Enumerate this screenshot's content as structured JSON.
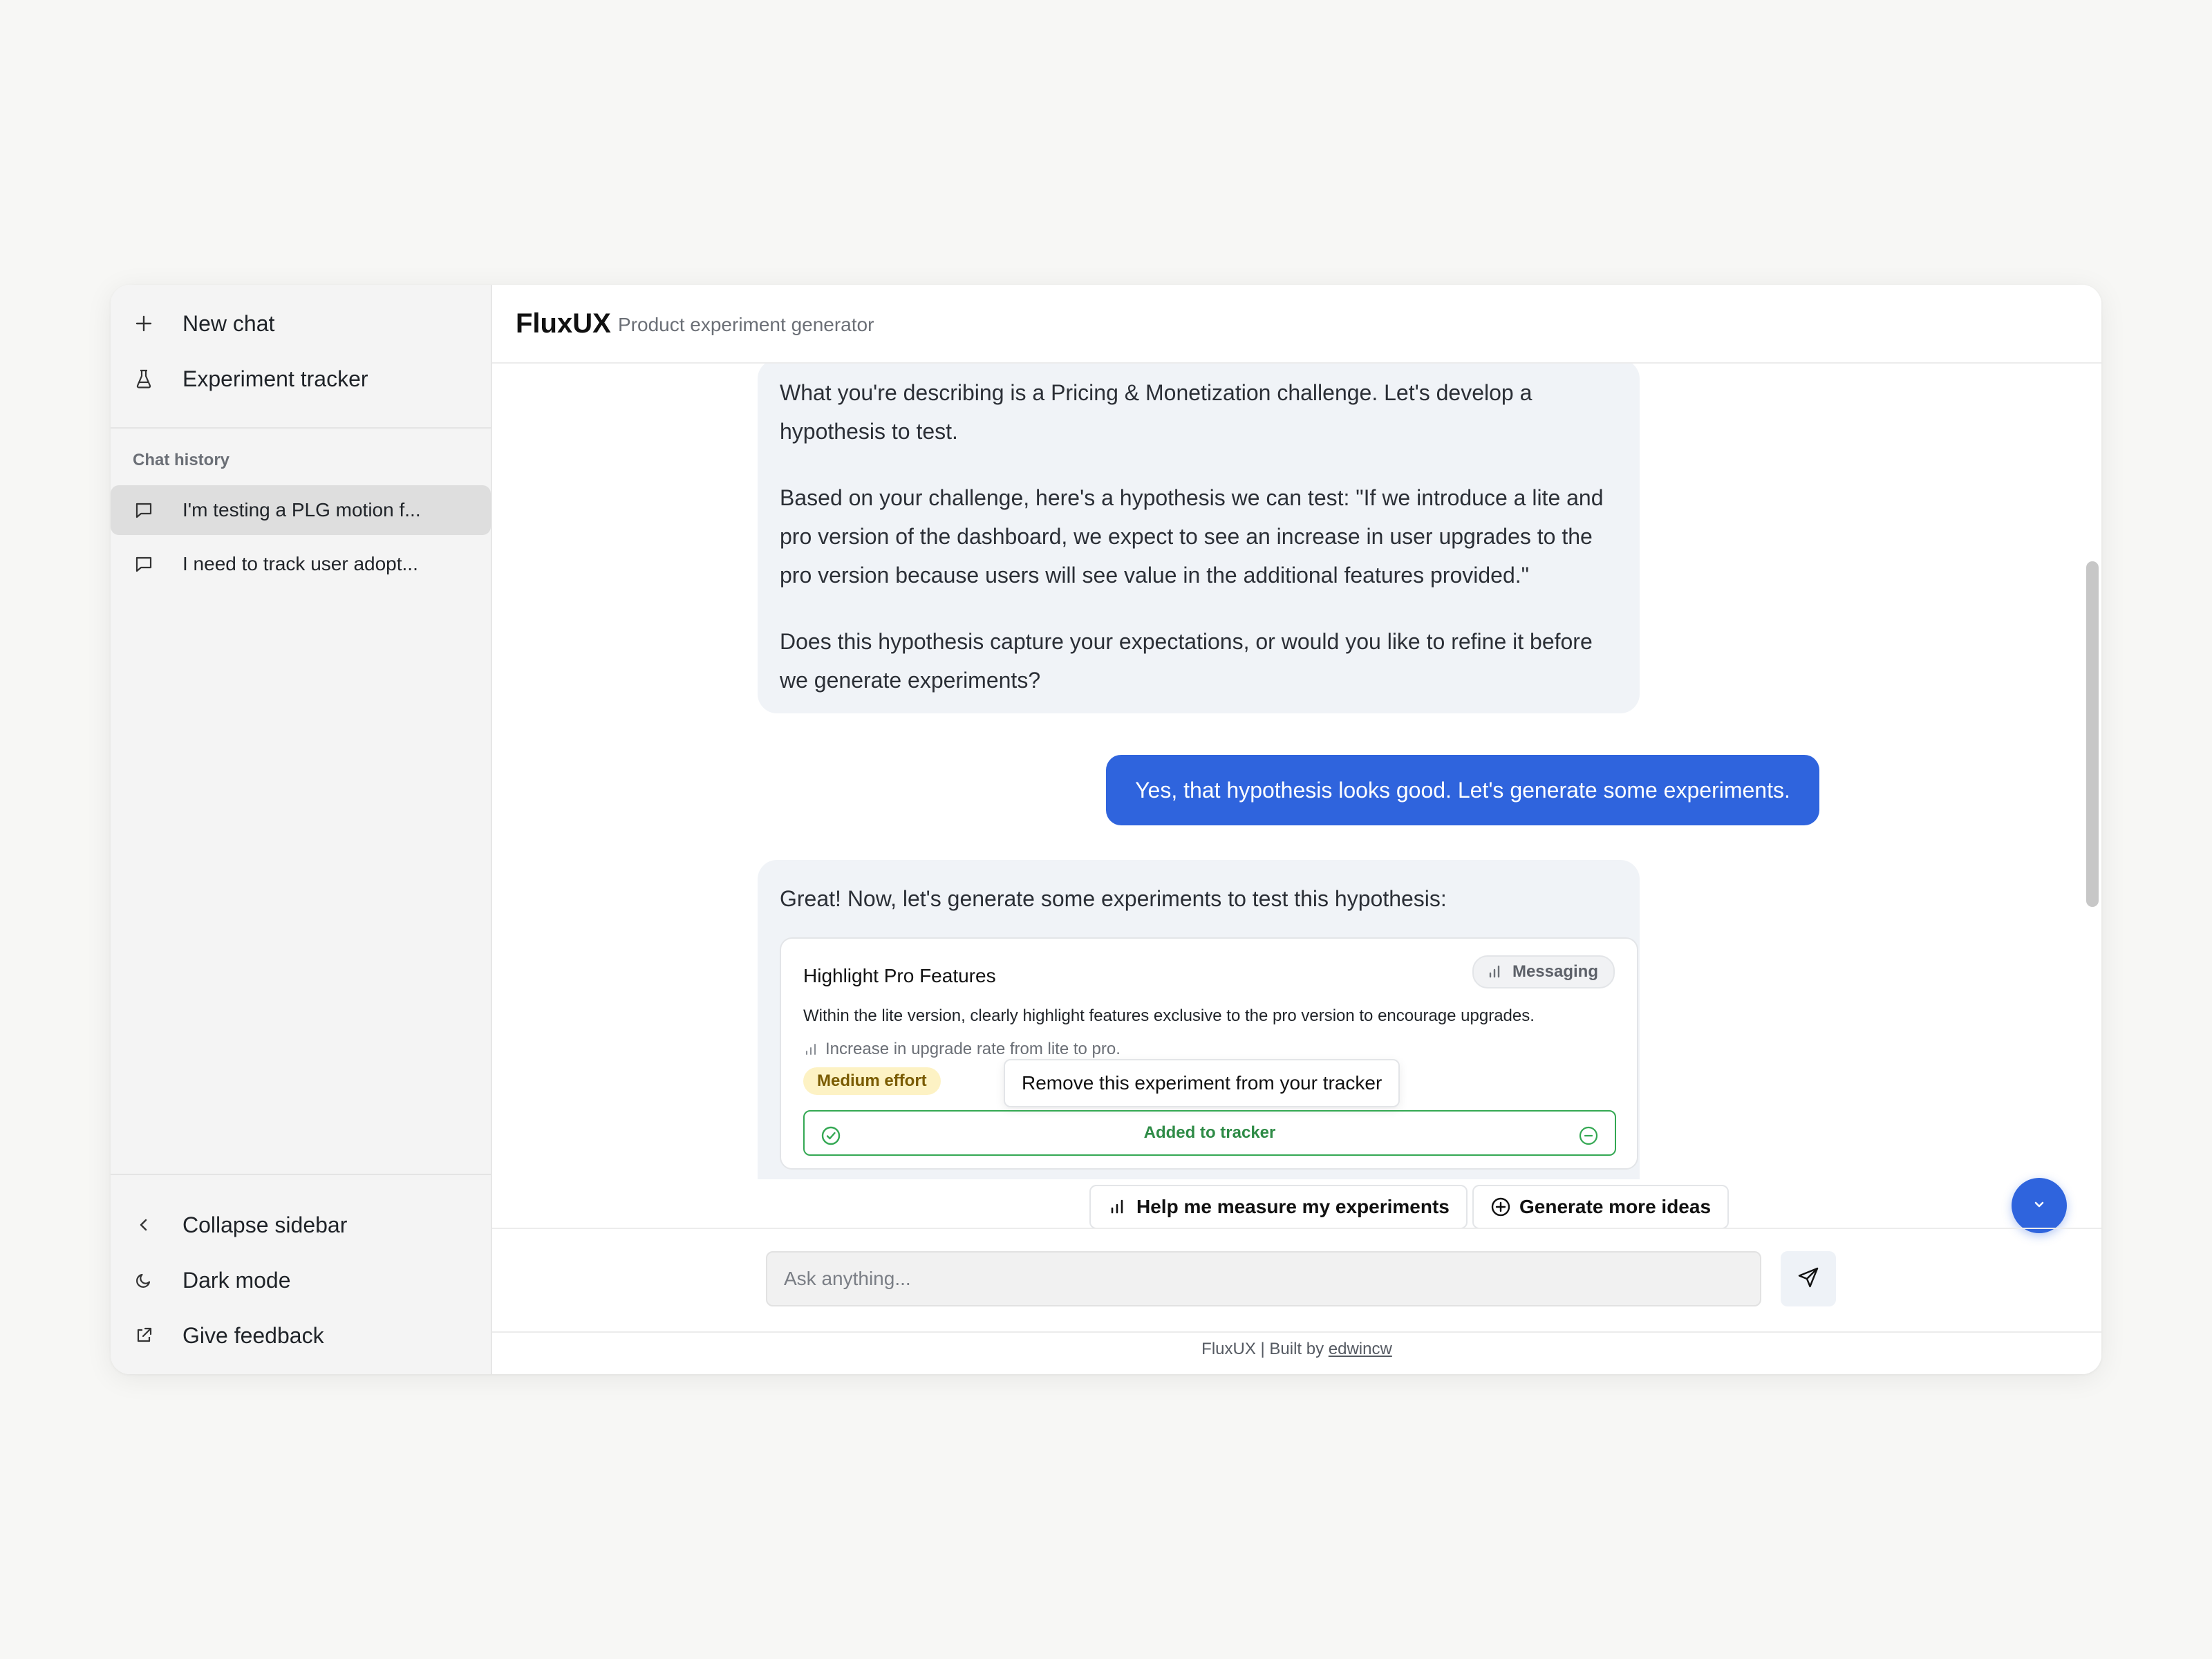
{
  "sidebar": {
    "top_items": [
      {
        "label": "New chat",
        "icon": "plus-icon"
      },
      {
        "label": "Experiment tracker",
        "icon": "flask-icon"
      }
    ],
    "history_title": "Chat history",
    "history": [
      {
        "label": "I'm testing a PLG motion f...",
        "icon": "chat-bubble-icon",
        "active": true
      },
      {
        "label": "I need to track user adopt...",
        "icon": "chat-bubble-icon",
        "active": false
      }
    ],
    "bottom_items": [
      {
        "label": "Collapse sidebar",
        "icon": "chevron-left-icon"
      },
      {
        "label": "Dark mode",
        "icon": "moon-icon"
      },
      {
        "label": "Give feedback",
        "icon": "external-link-icon"
      }
    ]
  },
  "header": {
    "brand": "FluxUX",
    "tagline": "Product experiment generator"
  },
  "messages": {
    "ai_1": {
      "p1": "What you're describing is a Pricing & Monetization challenge. Let's develop a hypothesis to test.",
      "p2": "Based on your challenge, here's a hypothesis we can test: \"If we introduce a lite and pro version of the dashboard, we expect to see an increase in user upgrades to the pro version because users will see value in the additional features provided.\"",
      "p3": "Does this hypothesis capture your expectations, or would you like to refine it before we generate experiments?"
    },
    "user_1": "Yes, that hypothesis looks good. Let's generate some experiments.",
    "ai_2": {
      "intro": "Great! Now, let's generate some experiments to test this hypothesis:"
    }
  },
  "experiment_card": {
    "title": "Highlight Pro Features",
    "category": "Messaging",
    "description": "Within the lite version, clearly highlight features exclusive to the pro version to encourage upgrades.",
    "metric": "Increase in upgrade rate from lite to pro.",
    "effort": "Medium effort",
    "tooltip": "Remove this experiment from your tracker",
    "status": "Added to tracker"
  },
  "suggestions": {
    "measure": "Help me measure my experiments",
    "more": "Generate more ideas"
  },
  "composer": {
    "placeholder": "Ask anything..."
  },
  "footer": {
    "prefix": "FluxUX | Built by",
    "author": "edwincw"
  },
  "colors": {
    "accent": "#2f64dd",
    "success": "#34a853",
    "effort_bg": "#fdf2c4",
    "ai_bubble": "#f0f3f7"
  }
}
